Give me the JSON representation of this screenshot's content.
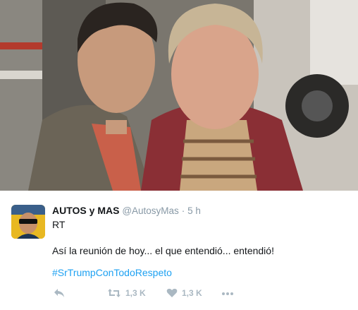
{
  "tweet": {
    "display_name": "AUTOS y MAS",
    "handle": "@AutosyMas",
    "separator": "·",
    "time": "5 h",
    "line1": "RT",
    "line2": "Así la reunión de hoy... el que entendió... entendió!",
    "hashtag": "#SrTrumpConTodoRespeto"
  },
  "actions": {
    "reply_icon": "reply-icon",
    "retweet_icon": "retweet-icon",
    "retweet_count": "1,3 K",
    "like_icon": "heart-icon",
    "like_count": "1,3 K",
    "more_icon": "more-dots-icon"
  },
  "colors": {
    "link": "#1da1f2",
    "muted": "#8899a6",
    "action": "#aab8c2",
    "text": "#14171a"
  }
}
